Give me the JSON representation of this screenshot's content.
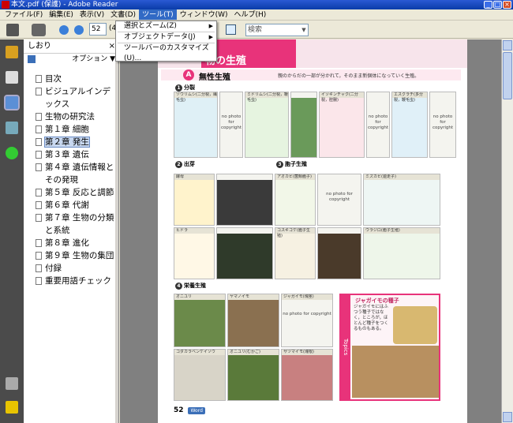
{
  "window": {
    "title": "本文.pdf (保護) - Adobe Reader"
  },
  "menubar": {
    "items": [
      "ファイル(F)",
      "編集(E)",
      "表示(V)",
      "文書(D)",
      "ツール(T)",
      "ウィンドウ(W)",
      "ヘルプ(H)"
    ],
    "active": "ツール(T)"
  },
  "toolbar": {
    "page_number": "52",
    "page_count_visible": "(4",
    "search_placeholder": "検索"
  },
  "tools_menu": {
    "items": [
      "選択とズーム(Z)",
      "オブジェクトデータ(J)",
      "ツールバーのカスタマイズ(U)..."
    ]
  },
  "bookmarks": {
    "title": "しおり",
    "options_label": "オプション",
    "items": [
      "目次",
      "ビジュアルインデックス",
      "生物の研究法",
      "第１章 細胞",
      "第２章 発生",
      "第３章 遺伝",
      "第４章 遺伝情報とその発現",
      "第５章 反応と調節",
      "第６章 代謝",
      "第７章 生物の分類と系統",
      "第８章 進化",
      "第９章 生物の集団",
      "付録",
      "重要用語チェック"
    ],
    "selected_index": 4
  },
  "page": {
    "header_title": "物の生殖",
    "section_letter": "A",
    "section_label": "無性生殖",
    "section_desc": "親のからだの一部が分かれて，そのまま新個体になっていく生殖。",
    "sub1": {
      "num": "1",
      "label": "分裂"
    },
    "sub2": {
      "num": "2",
      "label": "出芽"
    },
    "sub3": {
      "num": "3",
      "label": "胞子生殖"
    },
    "sub4": {
      "num": "4",
      "label": "栄養生殖"
    },
    "no_photo": "no photo for copyright",
    "row1_captions": [
      "ゾウリムシ(二分裂，繊毛虫)",
      "ミドリムシ(二分裂，鞭毛虫)",
      "イソギンチャク(二分裂，腔腸)",
      "エスクラチ(多分裂，鞭毛虫)"
    ],
    "row2_captions": [
      "酵母",
      "アオカビ(菌類胞子)",
      "ミズカビ(遊走子)"
    ],
    "row3_captions": [
      "ヒドラ",
      "コスギゴケ(胞子生殖)",
      "ウラジロ(胞子生殖)"
    ],
    "row4_captions": [
      "オニユリ",
      "ヤマノイモ",
      "ジャガイモ(塊茎)",
      "コダカラベンケイソウ",
      "オニユリ(むかご)",
      "サツマイモ(塊根)"
    ],
    "topics": {
      "label": "Topics",
      "title": "ジャガイモの種子",
      "body": "ジャガイモにはふつう種子ではなく，ところが，ほとんど種子をつくるものもある。"
    },
    "footer": {
      "page": "52",
      "word": "Word"
    }
  },
  "colors": {
    "accent": "#e8337a",
    "titlebar": "#0a3ca8",
    "panel_bg": "#4b4b4b"
  }
}
